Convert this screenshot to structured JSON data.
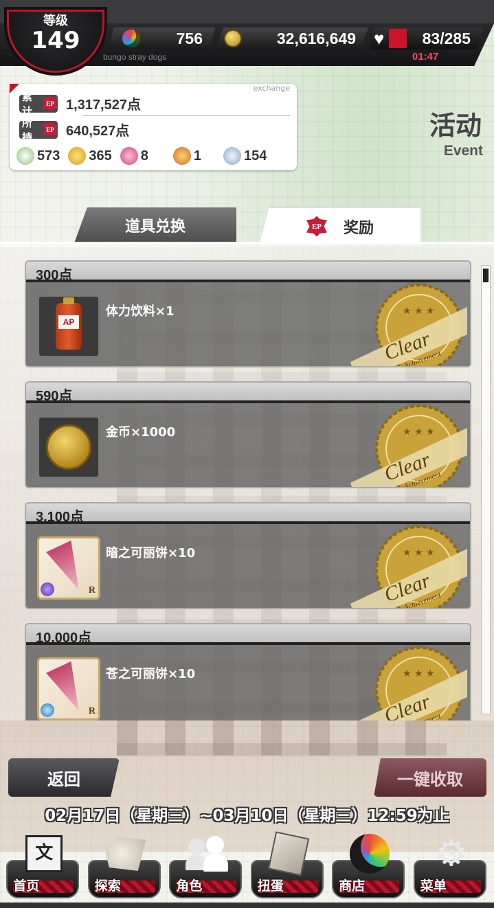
{
  "header": {
    "level_label": "等级",
    "level_value": "149",
    "gems": "756",
    "gold": "32,616,649",
    "ap": "83/285",
    "subtitle": "bungo stray dogs",
    "timer": "01:47"
  },
  "points": {
    "exchange_tag": "exchange",
    "total_label": "累计",
    "total_icon": "EP",
    "total_value": "1,317,527点",
    "owned_label": "所持",
    "owned_icon": "EP",
    "owned_value": "640,527点",
    "materials": [
      "573",
      "365",
      "8",
      "1",
      "154"
    ]
  },
  "page_title": {
    "cn": "活动",
    "en": "Event"
  },
  "tabs": [
    {
      "label": "道具兑换"
    },
    {
      "icon": "EP",
      "label": "奖励"
    }
  ],
  "rewards": [
    {
      "points": "300点",
      "item": "体力饮料×1"
    },
    {
      "points": "590点",
      "item": "金币×1000"
    },
    {
      "points": "3,100点",
      "item": "暗之可丽饼×10"
    },
    {
      "points": "10,000点",
      "item": "苍之可丽饼×10"
    }
  ],
  "seal": {
    "text": "Clear",
    "sub": "Achievement"
  },
  "buttons": {
    "back": "返回",
    "collect_all": "一键收取"
  },
  "period": "02月17日（星期三）~03月10日（星期三）12:59为止",
  "nav": [
    {
      "label": "首页",
      "icon": "bungo-logo-icon"
    },
    {
      "label": "探索",
      "icon": "tiger-icon"
    },
    {
      "label": "角色",
      "icon": "people-icon"
    },
    {
      "label": "扭蛋",
      "icon": "book-icon"
    },
    {
      "label": "商店",
      "icon": "crescent-gem-icon"
    },
    {
      "label": "菜单",
      "icon": "gear-icon"
    }
  ],
  "colors": {
    "accent_red": "#c0142a",
    "panel_dark": "#4a4a4a",
    "gold": "#c9a23a"
  }
}
